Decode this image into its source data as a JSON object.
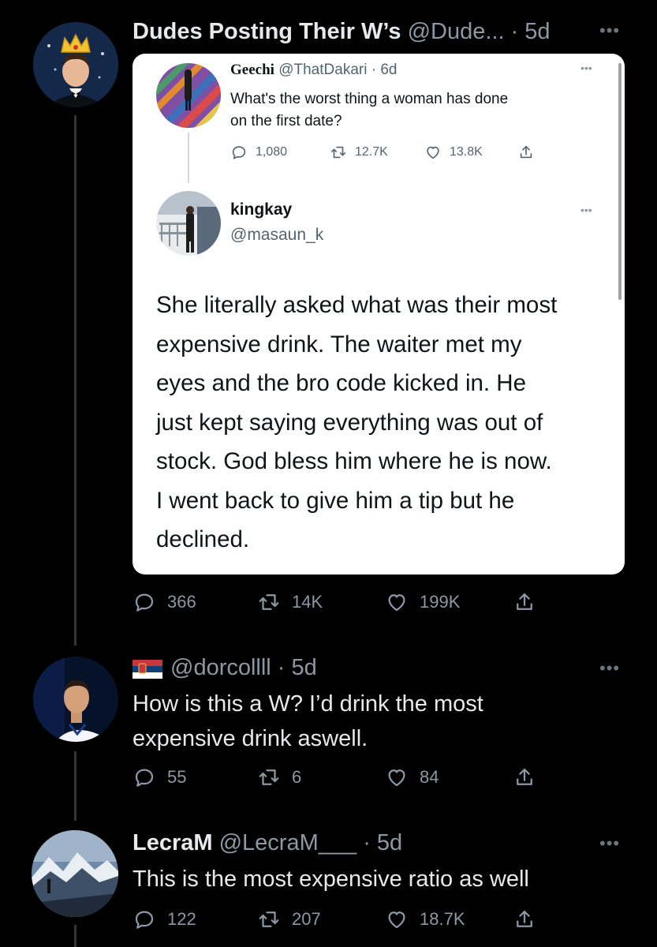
{
  "main_tweet": {
    "author_name": "Dudes Posting Their W’s",
    "handle_time": "@Dude... · 5d",
    "quoted": {
      "parent": {
        "name": "Geechi",
        "handle_time": "@ThatDakari · 6d",
        "text_line1": "What's the worst thing a woman has done",
        "text_line2": "on the first date?",
        "replies": "1,080",
        "retweets": "12.7K",
        "likes": "13.8K"
      },
      "reply": {
        "name": "kingkay",
        "handle": "@masaun_k",
        "lines": [
          "She literally asked what was their most",
          "expensive drink. The waiter met my",
          "eyes and the bro code kicked in. He",
          "just kept saying everything was out of",
          "stock. God bless him where he is now.",
          "I went back to give him a tip but he",
          "declined."
        ]
      }
    },
    "replies": "366",
    "retweets": "14K",
    "likes": "199K"
  },
  "reply1": {
    "flag": "serbia-flag",
    "handle_time": "@dorcollll · 5d",
    "text_line1": "How is this a W? I’d drink the most",
    "text_line2": "expensive drink aswell.",
    "replies": "55",
    "retweets": "6",
    "likes": "84"
  },
  "reply2": {
    "name": "LecraM",
    "handle_time": "@LecraM___ · 5d",
    "text": "This is the most expensive ratio as well",
    "replies": "122",
    "retweets": "207",
    "likes": "18.7K"
  },
  "colors": {
    "background": "#000000",
    "text": "#e7e9ea",
    "muted": "#8b98a5",
    "card_bg": "#ffffff"
  },
  "icons": [
    "reply-icon",
    "retweet-icon",
    "like-icon",
    "share-icon",
    "more-icon"
  ]
}
